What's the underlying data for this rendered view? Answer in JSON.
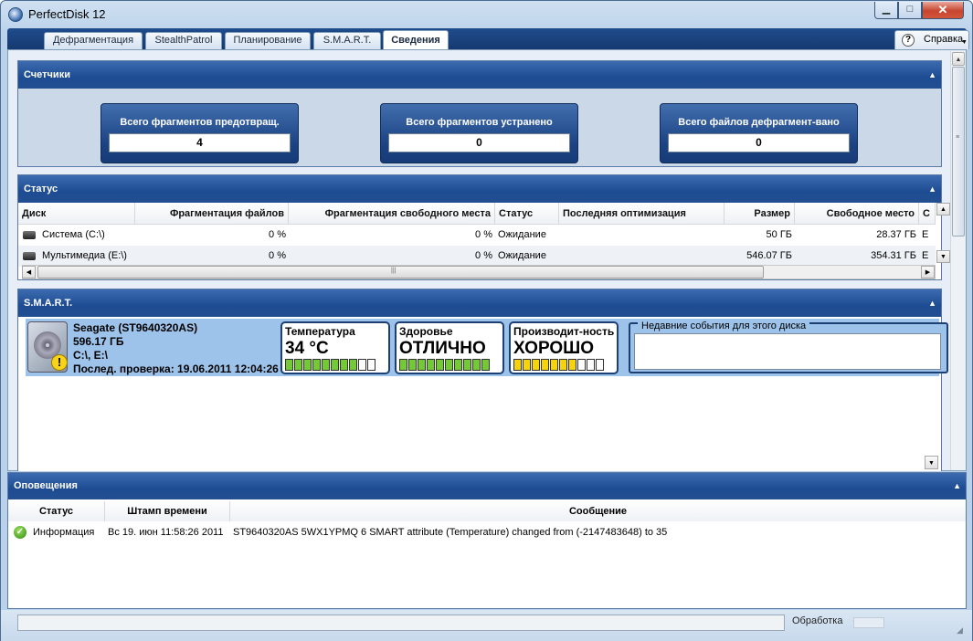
{
  "window": {
    "title": "PerfectDisk 12",
    "min": "▁",
    "max": "□",
    "close": "✕"
  },
  "tabs": [
    {
      "label": "Дефрагментация"
    },
    {
      "label": "StealthPatrol"
    },
    {
      "label": "Планирование"
    },
    {
      "label": "S.M.A.R.T."
    },
    {
      "label": "Сведения",
      "active": true
    }
  ],
  "help": {
    "label": "Справка",
    "icon": "?"
  },
  "counters": {
    "title": "Счетчики",
    "items": [
      {
        "label": "Всего фрагментов предотвращ.",
        "value": "4"
      },
      {
        "label": "Всего фрагментов устранено",
        "value": "0"
      },
      {
        "label": "Всего файлов дефрагмент-вано",
        "value": "0"
      }
    ]
  },
  "status": {
    "title": "Статус",
    "columns": [
      "Диск",
      "Фрагментация файлов",
      "Фрагментация свободного места",
      "Статус",
      "Последняя оптимизация",
      "Размер",
      "Свободное место",
      "С"
    ],
    "rows": [
      {
        "disk": "Система (C:\\)",
        "file_frag": "0 %",
        "free_frag": "0 %",
        "status": "Ожидание",
        "last_opt": "",
        "size": "50 ГБ",
        "free": "28.37 ГБ",
        "extra": "Е"
      },
      {
        "disk": "Мультимедиа (E:\\)",
        "file_frag": "0 %",
        "free_frag": "0 %",
        "status": "Ожидание",
        "last_opt": "",
        "size": "546.07 ГБ",
        "free": "354.31 ГБ",
        "extra": "Е"
      }
    ]
  },
  "smart": {
    "title": "S.M.A.R.T.",
    "disk": {
      "model": "Seagate (ST9640320AS)",
      "capacity": "596.17 ГБ",
      "volumes": "C:\\, E:\\",
      "last_check": "Послед. проверка: 19.06.2011 12:04:26"
    },
    "metrics": [
      {
        "label": "Температура",
        "value": "34 °C",
        "level": 8,
        "of": 10,
        "color": "#73c936"
      },
      {
        "label": "Здоровье",
        "value": "ОТЛИЧНО",
        "level": 10,
        "of": 10,
        "color": "#73c936"
      },
      {
        "label": "Производит-ность",
        "value": "ХОРОШО",
        "level": 7,
        "of": 10,
        "color": "#f5d40e"
      }
    ],
    "events_title": "Недавние события для этого диска"
  },
  "notifications": {
    "title": "Оповещения",
    "columns": [
      "Статус",
      "Штамп времени",
      "Сообщение"
    ],
    "rows": [
      {
        "status": "Информация",
        "time": "Вс 19. июн 11:58:26 2011",
        "message": "ST9640320AS 5WX1YPMQ 6 SMART attribute (Temperature) changed from (-2147483648) to 35"
      }
    ]
  },
  "statusbar": {
    "label": "Обработка",
    "progress": 0
  }
}
